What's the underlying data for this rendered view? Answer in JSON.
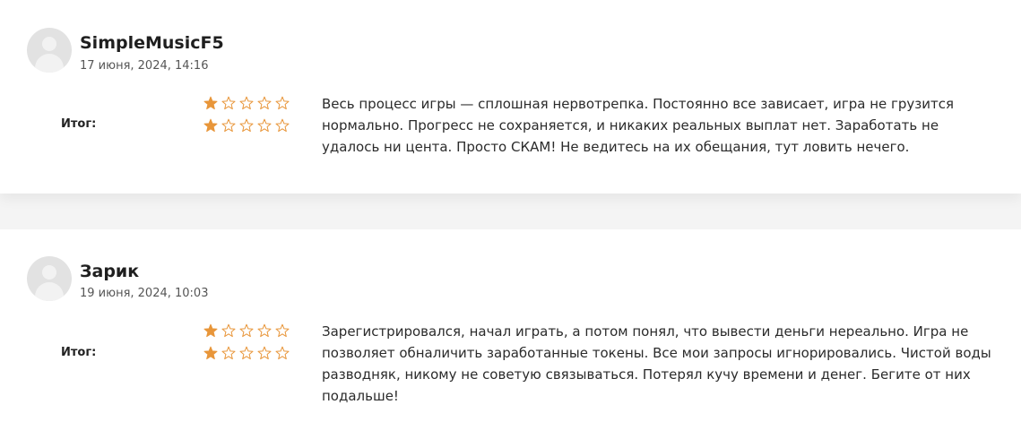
{
  "reviews": [
    {
      "author": "SimpleMusicF5",
      "date": "17 июня, 2024, 14:16",
      "summary_label": "Итог:",
      "ratings": [
        1,
        1
      ],
      "max_rating": 5,
      "text": "Весь процесс игры — сплошная нервотрепка. Постоянно все зависает, игра не грузится нормально. Прогресс не сохраняется, и никаких реальных выплат нет. Заработать не удалось ни цента. Просто СКАМ! Не ведитесь на их обещания, тут ловить нечего."
    },
    {
      "author": "Зарик",
      "date": "19 июня, 2024, 10:03",
      "summary_label": "Итог:",
      "ratings": [
        1,
        1
      ],
      "max_rating": 5,
      "text": "Зарегистрировался, начал играть, а потом понял, что вывести деньги нереально. Игра не позволяет обналичить заработанные токены. Все мои запросы игнорировались. Чистой воды разводняк, никому не советую связываться. Потерял кучу времени и денег. Бегите от них подальше!"
    }
  ],
  "colors": {
    "star_filled": "#e8963a",
    "star_empty": "#e8963a",
    "avatar_bg": "#e2e2e2"
  },
  "icons": {
    "star_filled": "star-filled-icon",
    "star_empty": "star-outline-icon",
    "avatar": "user-avatar-icon"
  }
}
